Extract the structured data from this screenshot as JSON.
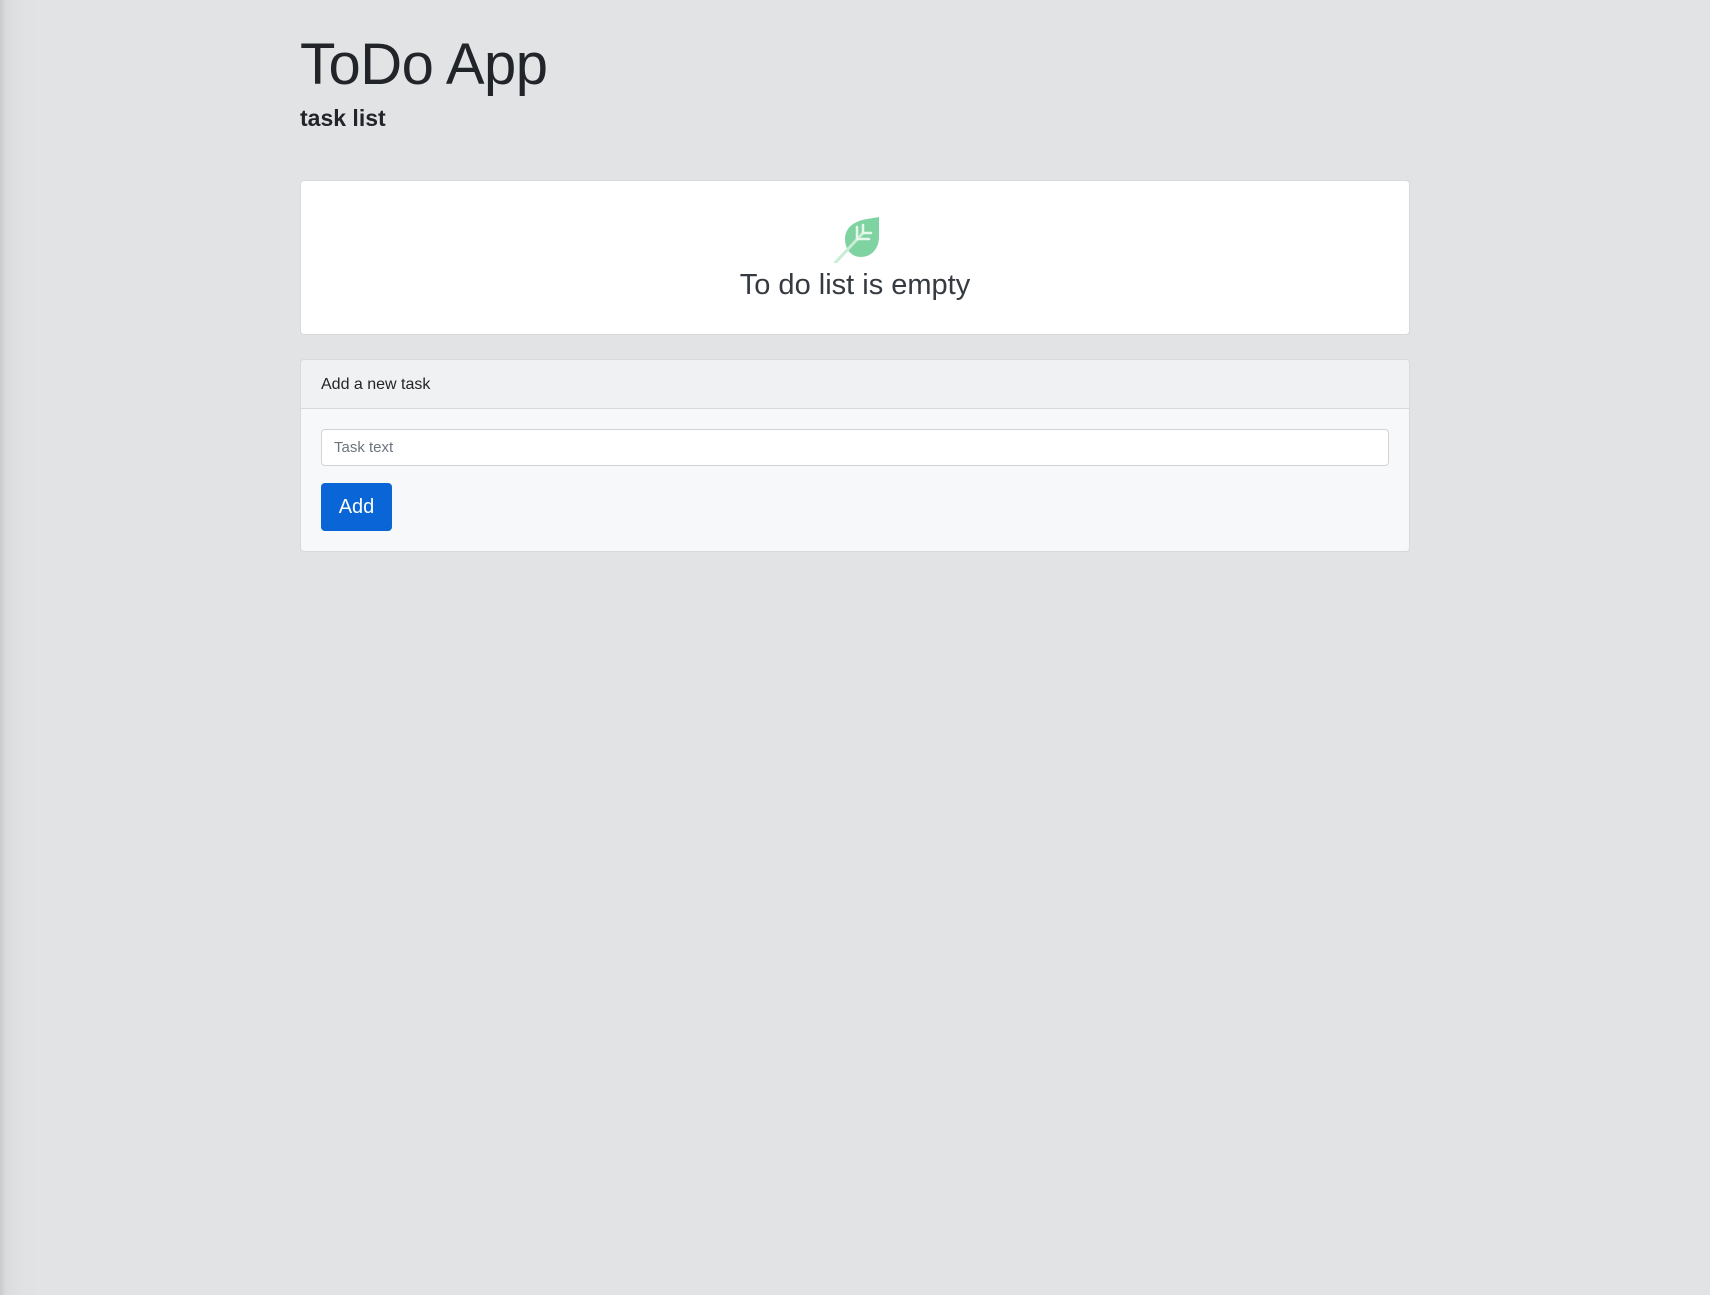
{
  "header": {
    "title": "ToDo App",
    "subtitle": "task list"
  },
  "empty_state": {
    "icon": "leaf-icon",
    "message": "To do list is empty",
    "icon_color": "#6fcf97"
  },
  "add_task": {
    "header_label": "Add a new task",
    "input_placeholder": "Task text",
    "input_value": "",
    "button_label": "Add",
    "button_color": "#0a66d6"
  },
  "colors": {
    "background": "#e2e3e5",
    "card": "#ffffff"
  }
}
